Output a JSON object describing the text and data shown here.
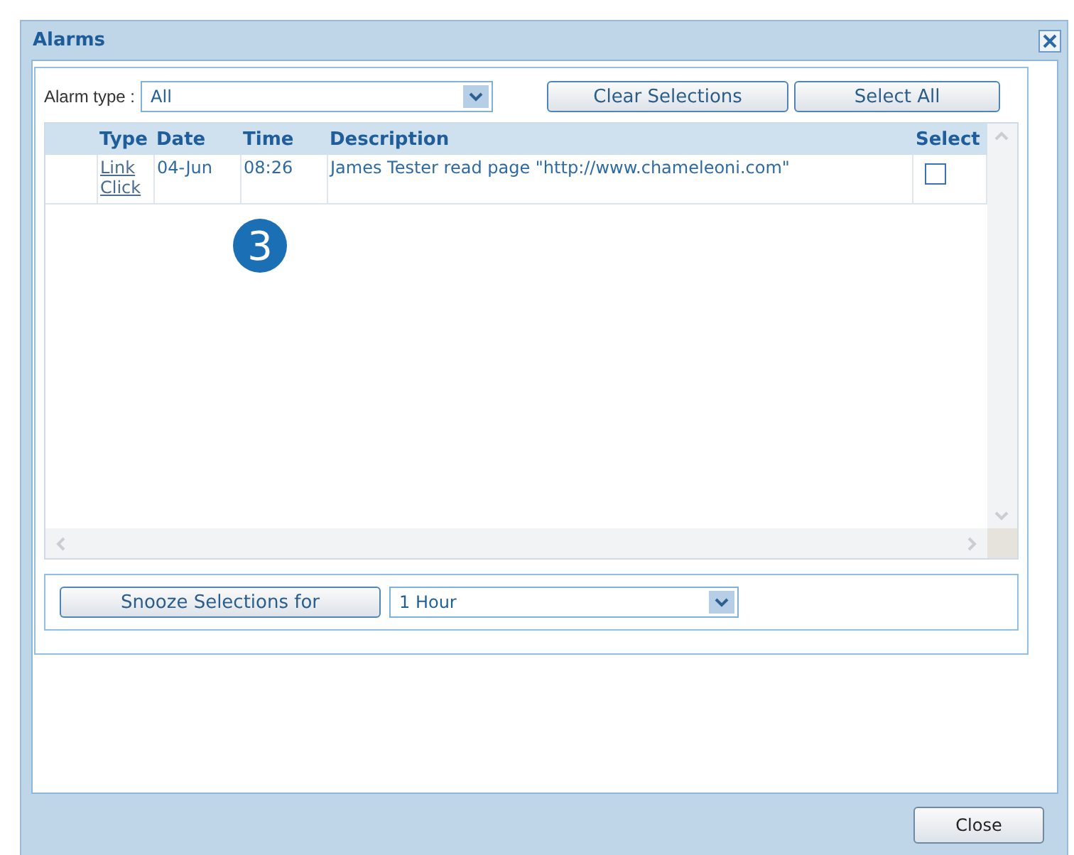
{
  "window": {
    "title": "Alarms"
  },
  "filter": {
    "label": "Alarm type :",
    "value": "All"
  },
  "actions": [
    "Clear Selections",
    "Select All"
  ],
  "table": {
    "columns": [
      "Type",
      "Date",
      "Time",
      "Description",
      "Select"
    ],
    "rows": [
      {
        "type": "Link Click",
        "date": "04-Jun",
        "time": "08:26",
        "description": "James Tester read page \"http://www.chameleoni.com\"",
        "checked": false
      }
    ]
  },
  "callout": "3",
  "snooze": {
    "button": "Snooze Selections for",
    "value": "1 Hour"
  },
  "footer_button": "Close"
}
